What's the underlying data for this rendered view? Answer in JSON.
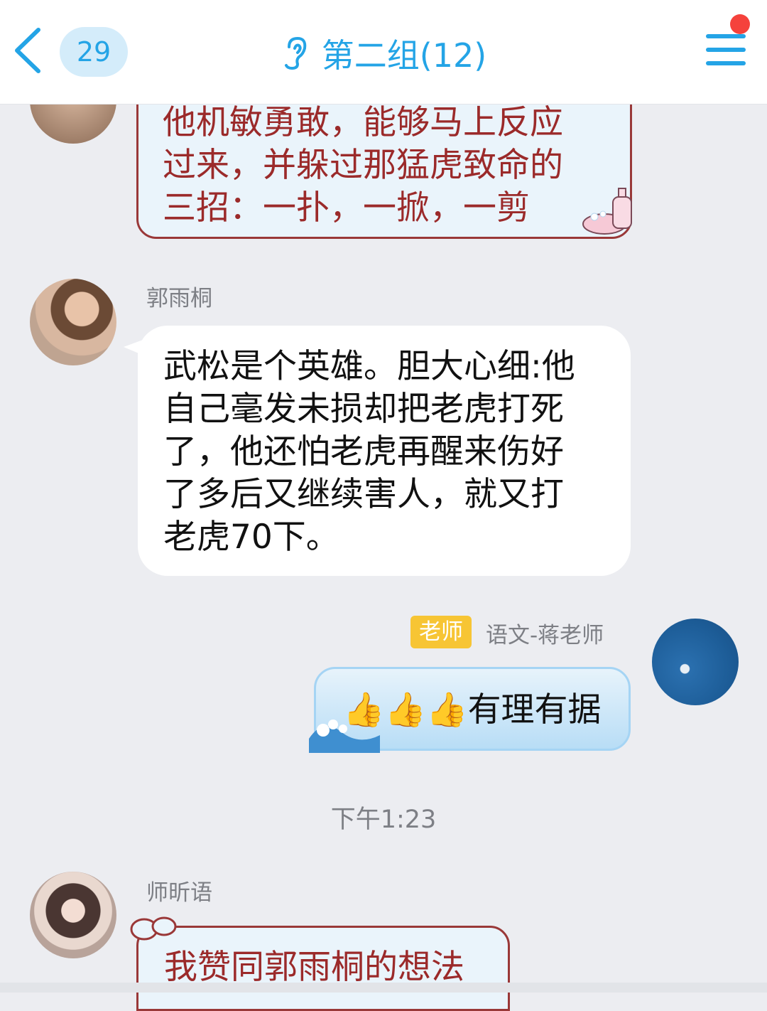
{
  "header": {
    "unread_count": "29",
    "title": "第二组(12)"
  },
  "messages": [
    {
      "text_lines": [
        "他机敏勇敢，能够马上反应",
        "过来，并躲过那猛虎致命的",
        "三招：一扑，一掀，一剪"
      ]
    },
    {
      "sender": "郭雨桐",
      "text_lines": [
        "武松是个英雄。胆大心细:他",
        "自己毫发未损却把老虎打死",
        "了，他还怕老虎再醒来伤好",
        "了多后又继续害人，就又打",
        "老虎70下。"
      ]
    },
    {
      "role_tag": "老师",
      "sender": "语文-蒋老师",
      "emoji": "👍👍👍",
      "text": "有理有据"
    },
    {
      "time": "下午1:23"
    },
    {
      "sender": "师昕语",
      "text": "我赞同郭雨桐的想法"
    }
  ],
  "colors": {
    "accent": "#24a4e6",
    "badge_bg": "#d4ecfa",
    "notif_dot": "#f5423c",
    "teacher_tag": "#f7c534",
    "decorated_text": "#9b2a2a"
  }
}
